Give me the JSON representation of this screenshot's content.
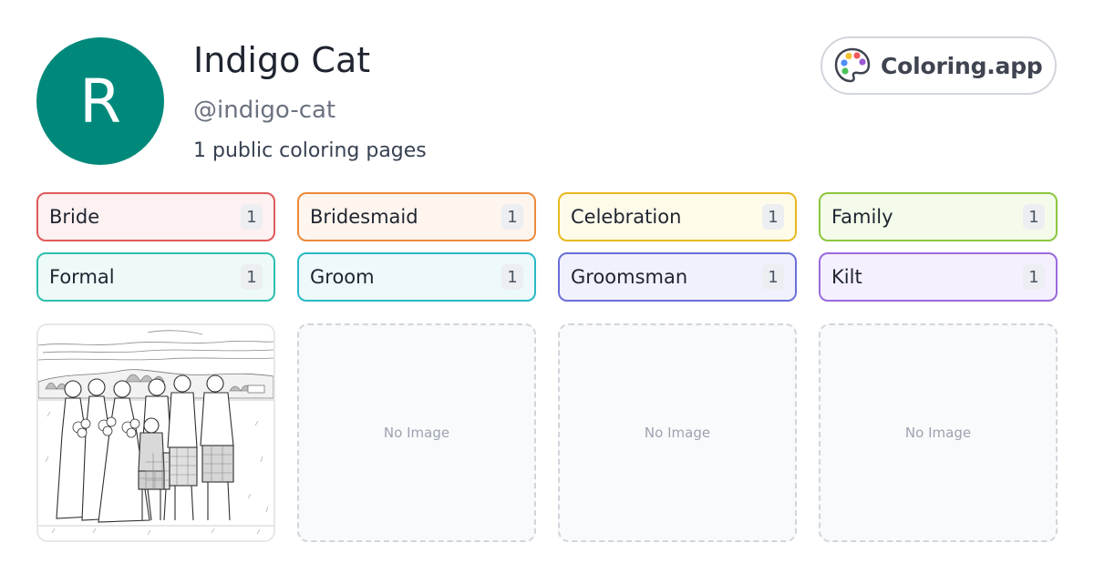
{
  "profile": {
    "initial": "R",
    "name": "Indigo Cat",
    "handle": "@indigo-cat",
    "count_text": "1 public coloring pages",
    "avatar_color": "#00897b"
  },
  "brand": {
    "label": "Coloring.app",
    "icon": "palette-icon"
  },
  "tags": [
    {
      "label": "Bride",
      "count": "1",
      "border": "#e05a5a",
      "bg": "#fdf1f1",
      "badge": "#eceef1"
    },
    {
      "label": "Bridesmaid",
      "count": "1",
      "border": "#ee8a3a",
      "bg": "#fef5ee",
      "badge": "#eceef1"
    },
    {
      "label": "Celebration",
      "count": "1",
      "border": "#e8b820",
      "bg": "#fefbea",
      "badge": "#eceef1"
    },
    {
      "label": "Family",
      "count": "1",
      "border": "#8cc63f",
      "bg": "#f4fbea",
      "badge": "#eceef1"
    },
    {
      "label": "Formal",
      "count": "1",
      "border": "#2dbfae",
      "bg": "#edfaf8",
      "badge": "#eceef1"
    },
    {
      "label": "Groom",
      "count": "1",
      "border": "#2ab8c6",
      "bg": "#edf9fb",
      "badge": "#eceef1"
    },
    {
      "label": "Groomsman",
      "count": "1",
      "border": "#6a6fd8",
      "bg": "#f0f1fc",
      "badge": "#eceef1"
    },
    {
      "label": "Kilt",
      "count": "1",
      "border": "#9a6adf",
      "bg": "#f5f0fd",
      "badge": "#eceef1"
    }
  ],
  "cards": [
    {
      "type": "image",
      "alt": "wedding-party-line-art"
    },
    {
      "type": "empty",
      "text": "No Image"
    },
    {
      "type": "empty",
      "text": "No Image"
    },
    {
      "type": "empty",
      "text": "No Image"
    }
  ]
}
